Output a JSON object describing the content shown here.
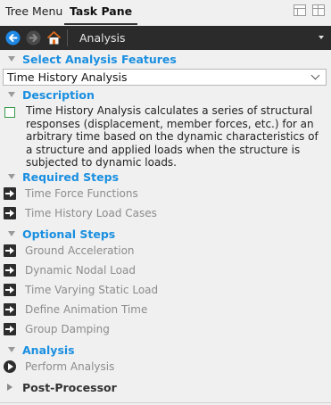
{
  "tabs": {
    "tree_menu": "Tree Menu",
    "task_pane": "Task Pane"
  },
  "nav": {
    "title": "Analysis",
    "back_icon": "arrow-left-circle",
    "forward_icon": "arrow-right",
    "home_icon": "house"
  },
  "select_features": {
    "title": "Select Analysis Features",
    "selected": "Time History Analysis"
  },
  "description": {
    "title": "Description",
    "text": "Time History Analysis calculates a series of structural responses (displacement, member forces, etc.) for an arbitrary time based on the dynamic characteristics of a structure and applied loads when the structure is subjected to dynamic loads."
  },
  "required_steps": {
    "title": "Required Steps",
    "items": [
      "Time Force Functions",
      "Time History Load Cases"
    ]
  },
  "optional_steps": {
    "title": "Optional Steps",
    "items": [
      "Ground Acceleration",
      "Dynamic Nodal Load",
      "Time Varying Static Load",
      "Define Animation Time",
      "Group Damping"
    ]
  },
  "analysis": {
    "title": "Analysis",
    "items": [
      "Perform Analysis"
    ]
  },
  "post_processor": {
    "title": "Post-Processor"
  },
  "colors": {
    "section_title": "#1a8fe0",
    "nav_bg": "#2b2b2b",
    "disabled_text": "#8c8c8c"
  }
}
